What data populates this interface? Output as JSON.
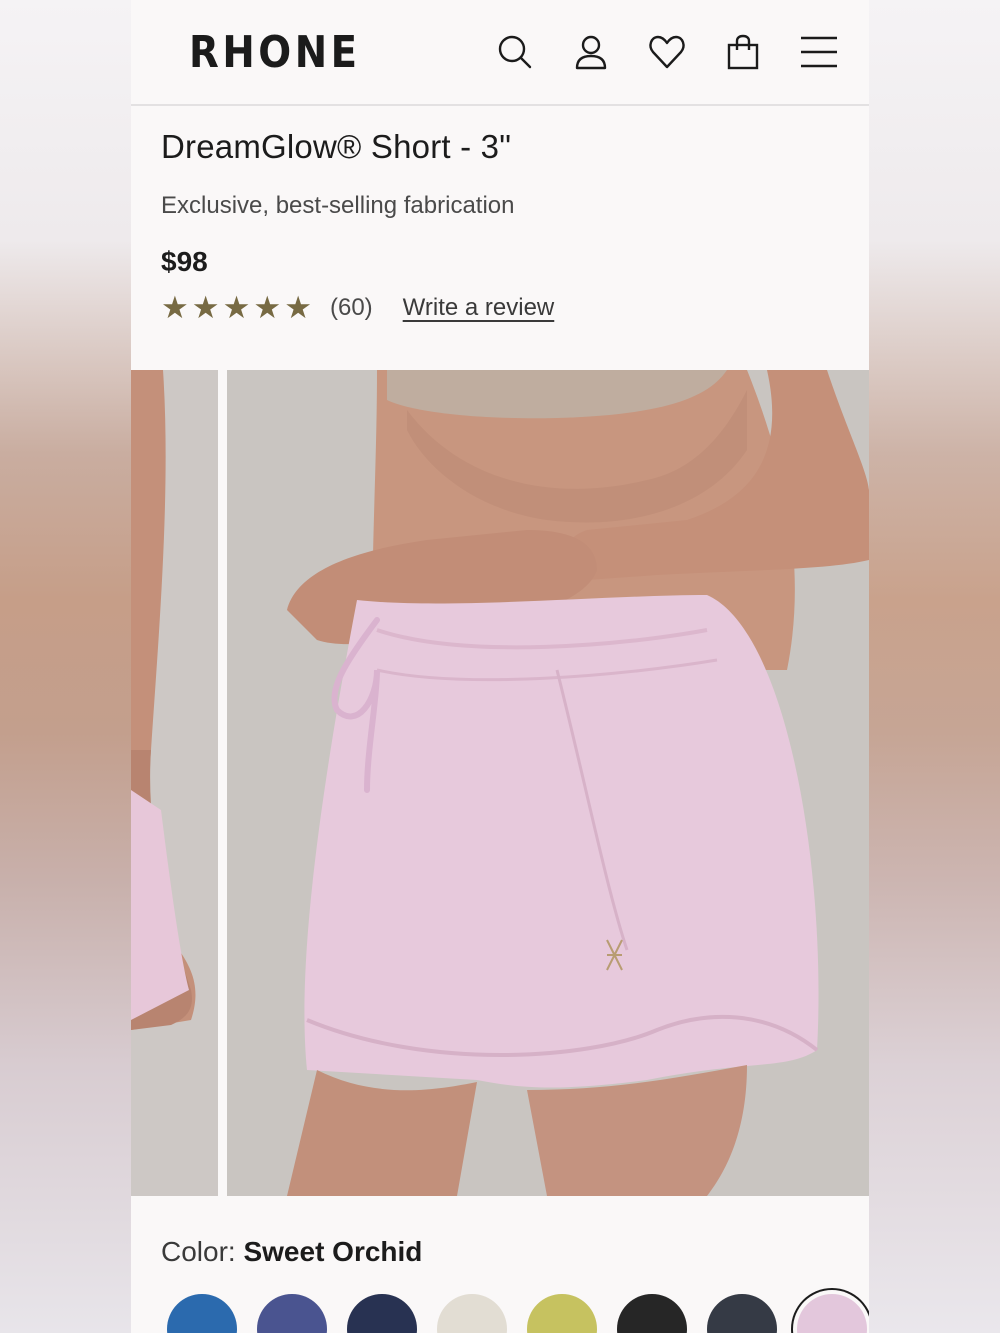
{
  "header": {
    "logo": "RHONE",
    "icons": [
      "search-icon",
      "account-icon",
      "wishlist-heart-icon",
      "shopping-bag-icon",
      "menu-icon"
    ]
  },
  "product": {
    "title": "DreamGlow® Short - 3\"",
    "subtitle": "Exclusive, best-selling fabrication",
    "price": "$98",
    "rating": 5,
    "review_count": "(60)",
    "write_review": "Write a review"
  },
  "color": {
    "label": "Color: ",
    "selected": "Sweet Orchid",
    "swatches": [
      {
        "color": "#2b6aae"
      },
      {
        "color": "#4a5490"
      },
      {
        "color": "#283252"
      },
      {
        "color": "#e2ddd3"
      },
      {
        "color": "#c6c260"
      },
      {
        "color": "#262626"
      },
      {
        "color": "#353a45"
      },
      {
        "color": "#e3c7dc",
        "selected": true
      }
    ]
  },
  "colors": {
    "star": "#776a43",
    "short_pink": "#e7c9dc",
    "background": "#faf8f8"
  }
}
